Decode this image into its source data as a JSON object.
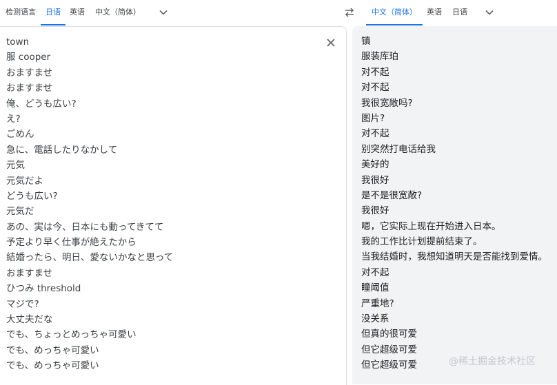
{
  "source_langs": {
    "detect": "检测语言",
    "japanese": "日语",
    "english": "英语",
    "chinese": "中文（简体）"
  },
  "target_langs": {
    "chinese": "中文（简体）",
    "english": "英语",
    "japanese": "日语"
  },
  "source_lines": [
    "town",
    "服 cooper",
    "おますませ",
    "おますませ",
    "俺、どうも広い?",
    "え?",
    "ごめん",
    "急に、電話したりなかして",
    "元気",
    "元気だよ",
    "どうも広い?",
    "元気だ",
    "あの、実は今、日本にも動ってきてて",
    "予定より早く仕事が絶えたから",
    "結婚ったら、明日、愛ないかなと思って",
    "おますませ",
    "ひつみ threshold",
    "マジで?",
    "大丈夫だな",
    "でも、ちょっとめっちゃ可愛い",
    "でも、めっちゃ可愛い",
    "でも、めっちゃ可愛い"
  ],
  "target_lines": [
    "镇",
    "服装库珀",
    "对不起",
    "对不起",
    "我很宽敞吗?",
    "图片?",
    "对不起",
    "别突然打电话给我",
    "美好的",
    "我很好",
    "是不是很宽敞?",
    "我很好",
    "嗯，它实际上现在开始进入日本。",
    "我的工作比计划提前结束了。",
    "当我结婚时，我想知道明天是否能找到爱情。",
    "对不起",
    "瞳阈值",
    "严重地?",
    "没关系",
    "但真的很可爱",
    "但它超级可爱",
    "但它超级可爱"
  ],
  "watermark": "@稀土掘金技术社区",
  "colors": {
    "accent": "#1a73e8",
    "text": "#3c4043",
    "target_bg": "#f1f3f4",
    "border": "#dadce0"
  },
  "icons": {
    "swap": "swap-languages-icon",
    "chevron": "chevron-down-icon",
    "clear": "close-icon"
  }
}
